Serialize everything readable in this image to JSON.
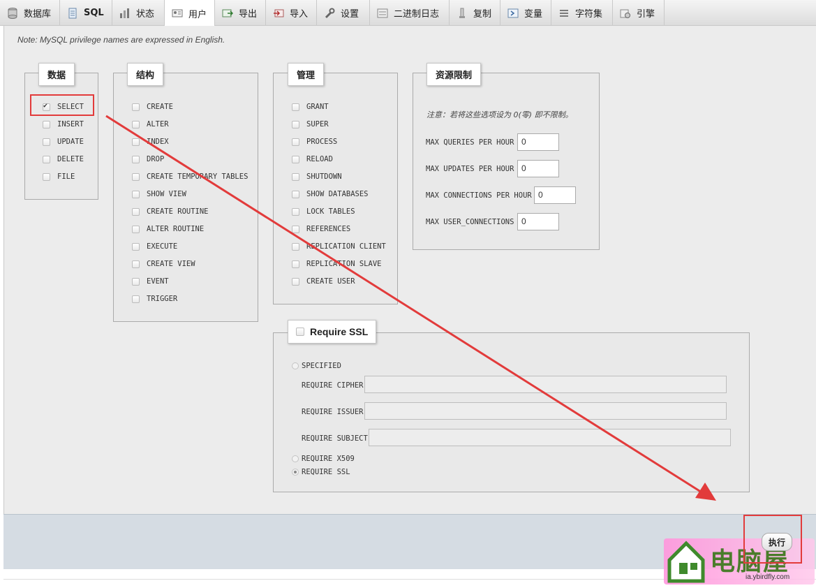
{
  "tabs": [
    {
      "label": "数据库",
      "icon": "database-icon"
    },
    {
      "label": "SQL",
      "icon": "sql-icon"
    },
    {
      "label": "状态",
      "icon": "status-icon"
    },
    {
      "label": "用户",
      "icon": "users-icon",
      "active": true
    },
    {
      "label": "导出",
      "icon": "export-icon"
    },
    {
      "label": "导入",
      "icon": "import-icon"
    },
    {
      "label": "设置",
      "icon": "wrench-icon"
    },
    {
      "label": "二进制日志",
      "icon": "binlog-icon"
    },
    {
      "label": "复制",
      "icon": "replication-icon"
    },
    {
      "label": "变量",
      "icon": "variables-icon"
    },
    {
      "label": "字符集",
      "icon": "charset-icon"
    },
    {
      "label": "引擎",
      "icon": "engines-icon"
    }
  ],
  "note": "Note: MySQL privilege names are expressed in English.",
  "data_group": {
    "legend": "数据",
    "items": [
      {
        "label": "SELECT",
        "checked": true
      },
      {
        "label": "INSERT",
        "checked": false
      },
      {
        "label": "UPDATE",
        "checked": false
      },
      {
        "label": "DELETE",
        "checked": false
      },
      {
        "label": "FILE",
        "checked": false
      }
    ]
  },
  "structure_group": {
    "legend": "结构",
    "items": [
      {
        "label": "CREATE"
      },
      {
        "label": "ALTER"
      },
      {
        "label": "INDEX"
      },
      {
        "label": "DROP"
      },
      {
        "label": "CREATE TEMPORARY TABLES"
      },
      {
        "label": "SHOW VIEW"
      },
      {
        "label": "CREATE ROUTINE"
      },
      {
        "label": "ALTER ROUTINE"
      },
      {
        "label": "EXECUTE"
      },
      {
        "label": "CREATE VIEW"
      },
      {
        "label": "EVENT"
      },
      {
        "label": "TRIGGER"
      }
    ]
  },
  "admin_group": {
    "legend": "管理",
    "items": [
      {
        "label": "GRANT"
      },
      {
        "label": "SUPER"
      },
      {
        "label": "PROCESS"
      },
      {
        "label": "RELOAD"
      },
      {
        "label": "SHUTDOWN"
      },
      {
        "label": "SHOW DATABASES"
      },
      {
        "label": "LOCK TABLES"
      },
      {
        "label": "REFERENCES"
      },
      {
        "label": "REPLICATION CLIENT"
      },
      {
        "label": "REPLICATION SLAVE"
      },
      {
        "label": "CREATE USER"
      }
    ]
  },
  "resource_group": {
    "legend": "资源限制",
    "note": "注意：若将这些选项设为 0(零) 即不限制。",
    "fields": [
      {
        "label": "MAX QUERIES PER HOUR",
        "value": "0"
      },
      {
        "label": "MAX UPDATES PER HOUR",
        "value": "0"
      },
      {
        "label": "MAX CONNECTIONS PER HOUR",
        "value": "0"
      },
      {
        "label": "MAX USER_CONNECTIONS",
        "value": "0"
      }
    ]
  },
  "ssl_group": {
    "legend": "Require SSL",
    "specified_label": "SPECIFIED",
    "cipher_label": "REQUIRE CIPHER",
    "issuer_label": "REQUIRE ISSUER",
    "subject_label": "REQUIRE SUBJECT",
    "x509_label": "REQUIRE X509",
    "ssl_label": "REQUIRE SSL",
    "selected": "REQUIRE SSL"
  },
  "footer": {
    "execute_label": "执行"
  },
  "watermark": {
    "text": "电脑屋",
    "url": "ia.ybirdfly.com"
  },
  "colors": {
    "highlight": "#e23b3b",
    "panel": "#ececec",
    "footer": "#d5dce3"
  }
}
